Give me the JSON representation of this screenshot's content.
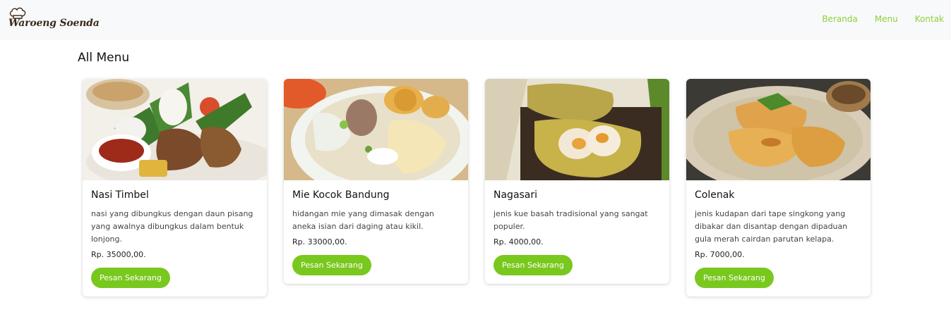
{
  "brand": {
    "name": "Waroeng Soenda",
    "logo_icon": "chef-hat-icon"
  },
  "nav": {
    "items": [
      {
        "label": "Beranda"
      },
      {
        "label": "Menu"
      },
      {
        "label": "Kontak"
      }
    ]
  },
  "page": {
    "title": "All Menu"
  },
  "menu": [
    {
      "name": "Nasi Timbel",
      "description": "nasi yang dibungkus dengan daun pisang yang awalnya dibungkus dalam bentuk lonjong.",
      "price": "Rp. 35000,00.",
      "button": "Pesan Sekarang"
    },
    {
      "name": "Mie Kocok Bandung",
      "description": "hidangan mie yang dimasak dengan aneka isian dari daging atau kikil.",
      "price": "Rp. 33000,00.",
      "button": "Pesan Sekarang"
    },
    {
      "name": "Nagasari",
      "description": "jenis kue basah tradisional yang sangat populer.",
      "price": "Rp. 4000,00.",
      "button": "Pesan Sekarang"
    },
    {
      "name": "Colenak",
      "description": "jenis kudapan dari tape singkong yang dibakar dan disantap dengan dipaduan gula merah cairdan parutan kelapa.",
      "price": "Rp. 7000,00.",
      "button": "Pesan Sekarang"
    }
  ],
  "colors": {
    "accent": "#79c81e",
    "nav_link": "#8cd13a",
    "navbar_bg": "#f8f9fa"
  }
}
